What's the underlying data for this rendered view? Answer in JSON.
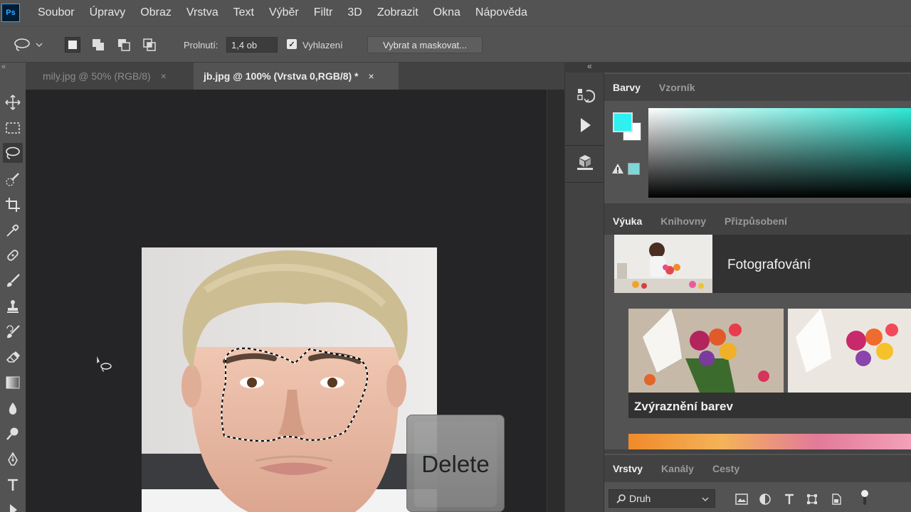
{
  "app": {
    "logo": "Ps"
  },
  "menu": [
    "Soubor",
    "Úpravy",
    "Obraz",
    "Vrstva",
    "Text",
    "Výběr",
    "Filtr",
    "3D",
    "Zobrazit",
    "Okna",
    "Nápověda"
  ],
  "options": {
    "feather_label": "Prolnutí:",
    "feather_value": "1,4 ob",
    "antialias_label": "Vyhlazení",
    "antialias_checked": true,
    "select_mask_label": "Vybrat a maskovat..."
  },
  "tabs": [
    {
      "label": "mily.jpg @ 50% (RGB/8)",
      "active": false
    },
    {
      "label": "jb.jpg @ 100% (Vrstva 0,RGB/8) *",
      "active": true
    }
  ],
  "tab_close": "×",
  "color_panel": {
    "tabs": [
      "Barvy",
      "Vzorník"
    ],
    "foreground": "#2ef0f0",
    "background": "#ffffff",
    "warning_swatch": "#7fd6d6"
  },
  "learn_panel": {
    "tabs": [
      "Výuka",
      "Knihovny",
      "Přizpůsobení"
    ],
    "topic_title": "Fotografování",
    "lesson_title": "Zvýraznění barev"
  },
  "layers_panel": {
    "tabs": [
      "Vrstvy",
      "Kanály",
      "Cesty"
    ],
    "kind_label": "Druh"
  },
  "key_overlay": {
    "label": "Delete"
  },
  "collapse_glyph": "«"
}
